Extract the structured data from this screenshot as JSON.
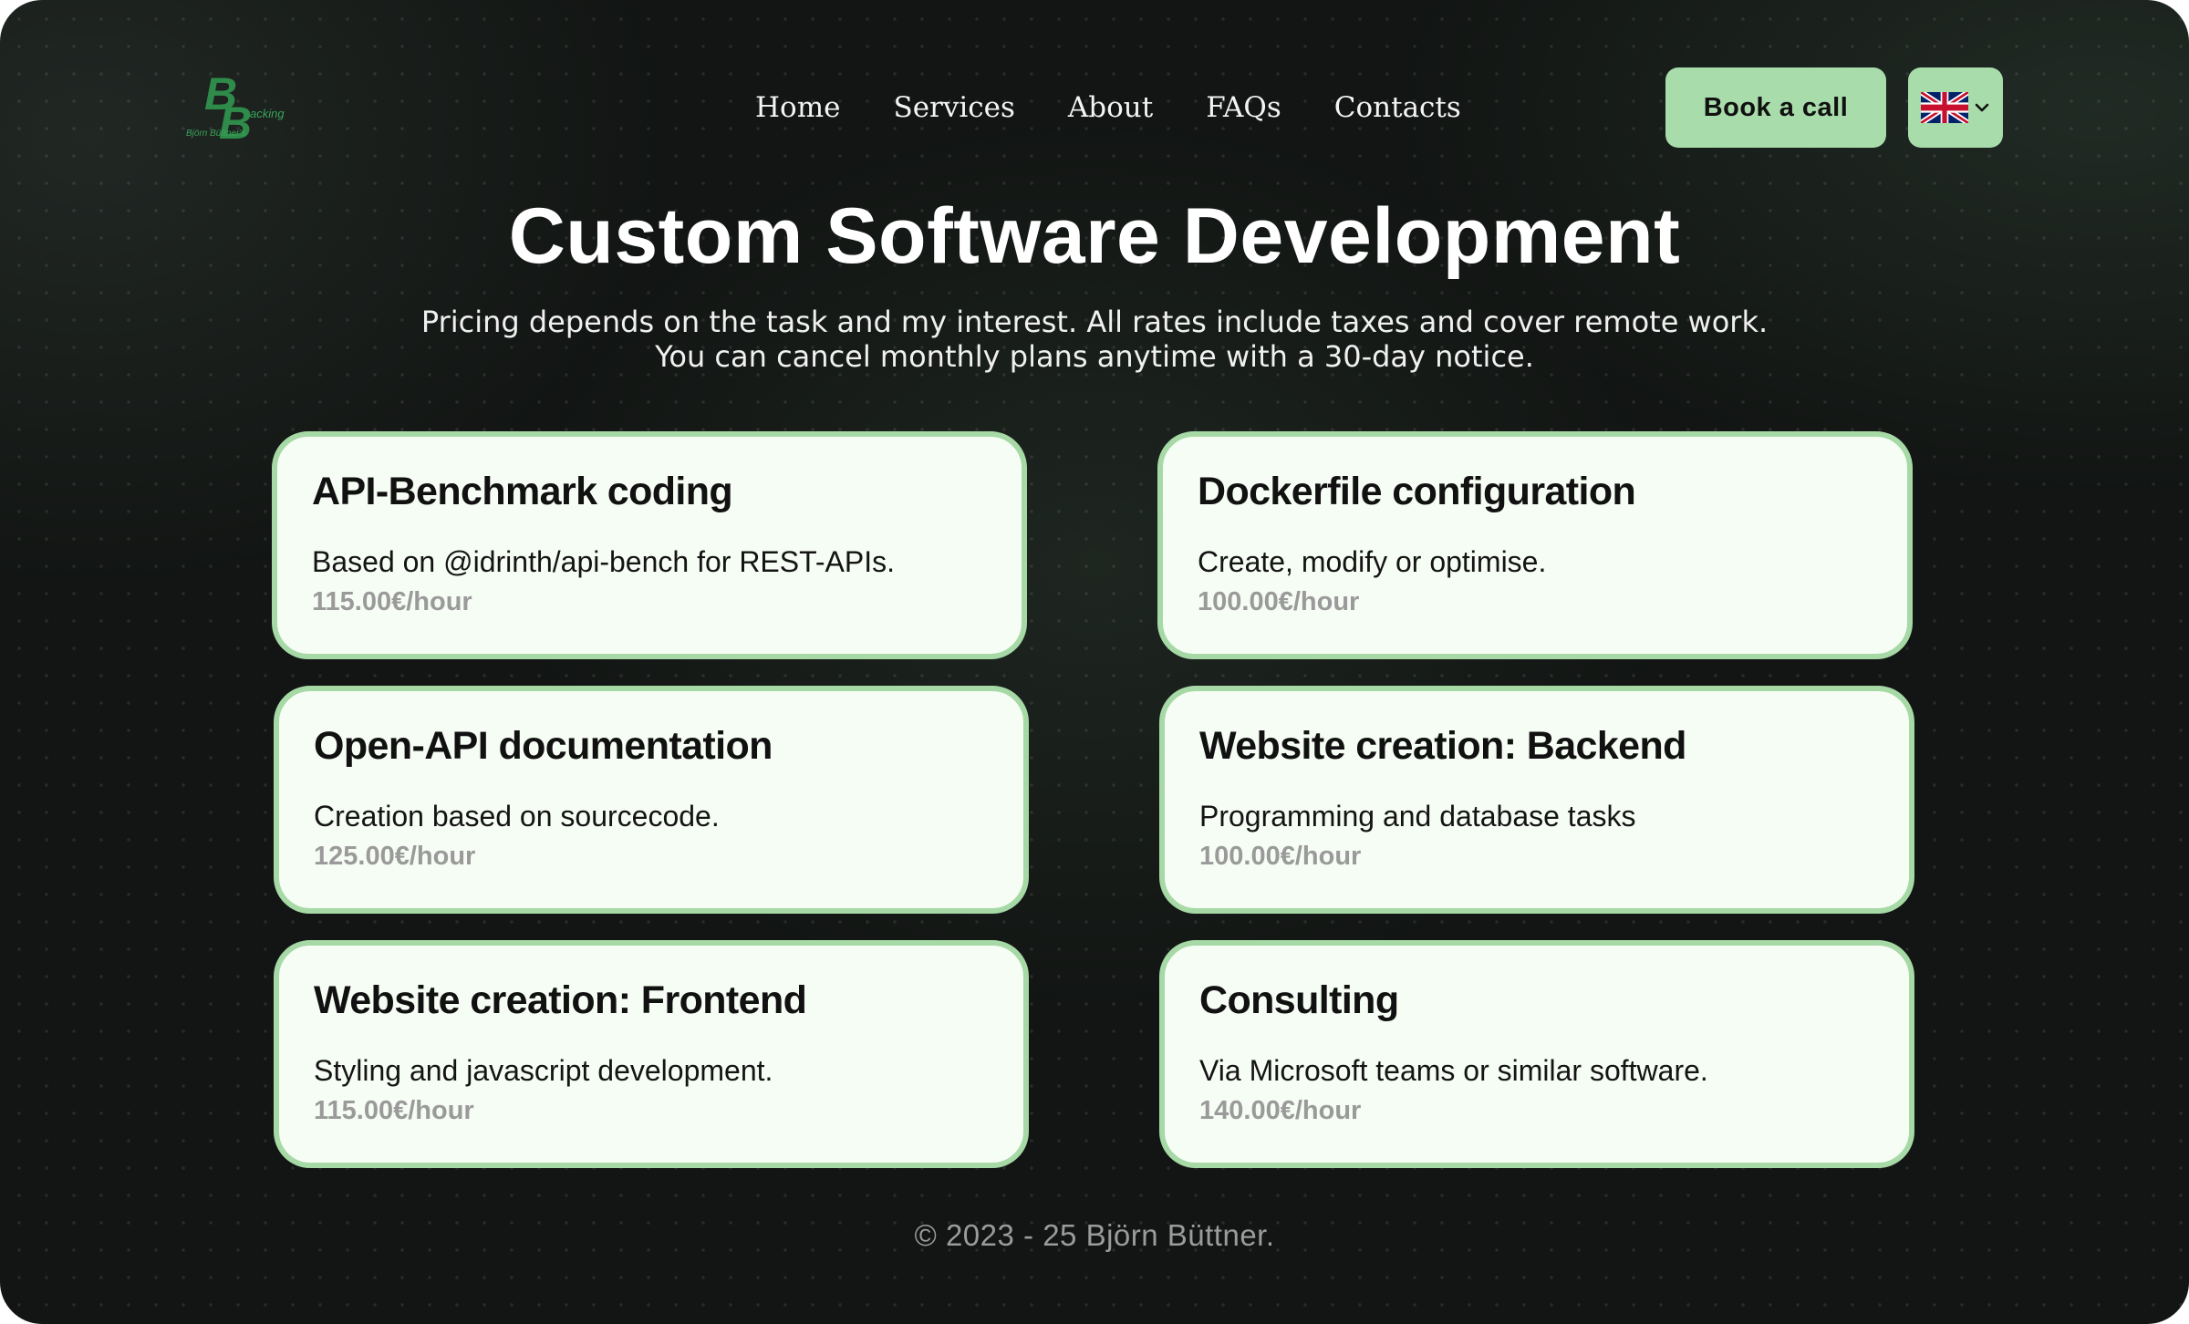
{
  "header": {
    "logo_text_small": "Björn Büttner's",
    "logo_text_wing": "acking",
    "nav": [
      {
        "label": "Home"
      },
      {
        "label": "Services"
      },
      {
        "label": "About"
      },
      {
        "label": "FAQs"
      },
      {
        "label": "Contacts"
      }
    ],
    "book_label": "Book a call",
    "language_icon": "uk-flag-icon"
  },
  "hero": {
    "title": "Custom Software Development",
    "subtitle_line1": "Pricing depends on the task and my interest. All rates include taxes and cover remote work.",
    "subtitle_line2": "You can cancel monthly plans anytime with a 30-day notice."
  },
  "services": [
    {
      "title": "API-Benchmark coding",
      "description": "Based on @idrinth/api-bench for REST-APIs.",
      "price": "115.00€/hour"
    },
    {
      "title": "Dockerfile configuration",
      "description": "Create, modify or optimise.",
      "price": "100.00€/hour"
    },
    {
      "title": "Open-API documentation",
      "description": "Creation based on sourcecode.",
      "price": "125.00€/hour"
    },
    {
      "title": "Website creation: Backend",
      "description": "Programming and database tasks",
      "price": "100.00€/hour"
    },
    {
      "title": "Website creation: Frontend",
      "description": "Styling and javascript development.",
      "price": "115.00€/hour"
    },
    {
      "title": "Consulting",
      "description": "Via Microsoft teams or similar software.",
      "price": "140.00€/hour"
    }
  ],
  "footer": {
    "copyright": "© 2023 - 25 Björn Büttner."
  },
  "colors": {
    "accent": "#a8dcaa",
    "background": "#121513",
    "card_background": "#f6fdf4",
    "price_text": "#9a9a9a"
  }
}
